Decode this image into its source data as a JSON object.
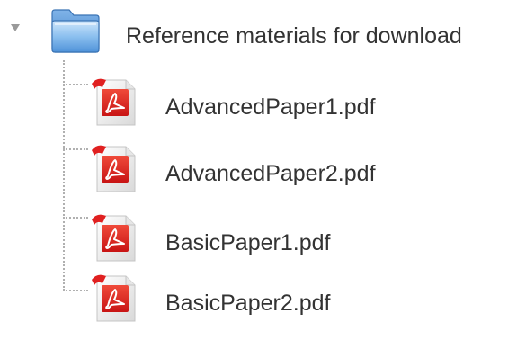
{
  "tree": {
    "folder": {
      "name": "Reference materials for download",
      "icon": "folder-icon",
      "expanded": true,
      "toggle_icon": "triangle-down-icon"
    },
    "files": [
      {
        "name": "AdvancedPaper1.pdf",
        "icon": "pdf-icon"
      },
      {
        "name": "AdvancedPaper2.pdf",
        "icon": "pdf-icon"
      },
      {
        "name": "BasicPaper1.pdf",
        "icon": "pdf-icon"
      },
      {
        "name": "BasicPaper2.pdf",
        "icon": "pdf-icon"
      }
    ]
  },
  "colors": {
    "folder_blue": "#4a8fd8",
    "folder_light": "#b9d8f7",
    "pdf_red": "#e02020",
    "text": "#333333",
    "connector": "#b0b0b0"
  }
}
